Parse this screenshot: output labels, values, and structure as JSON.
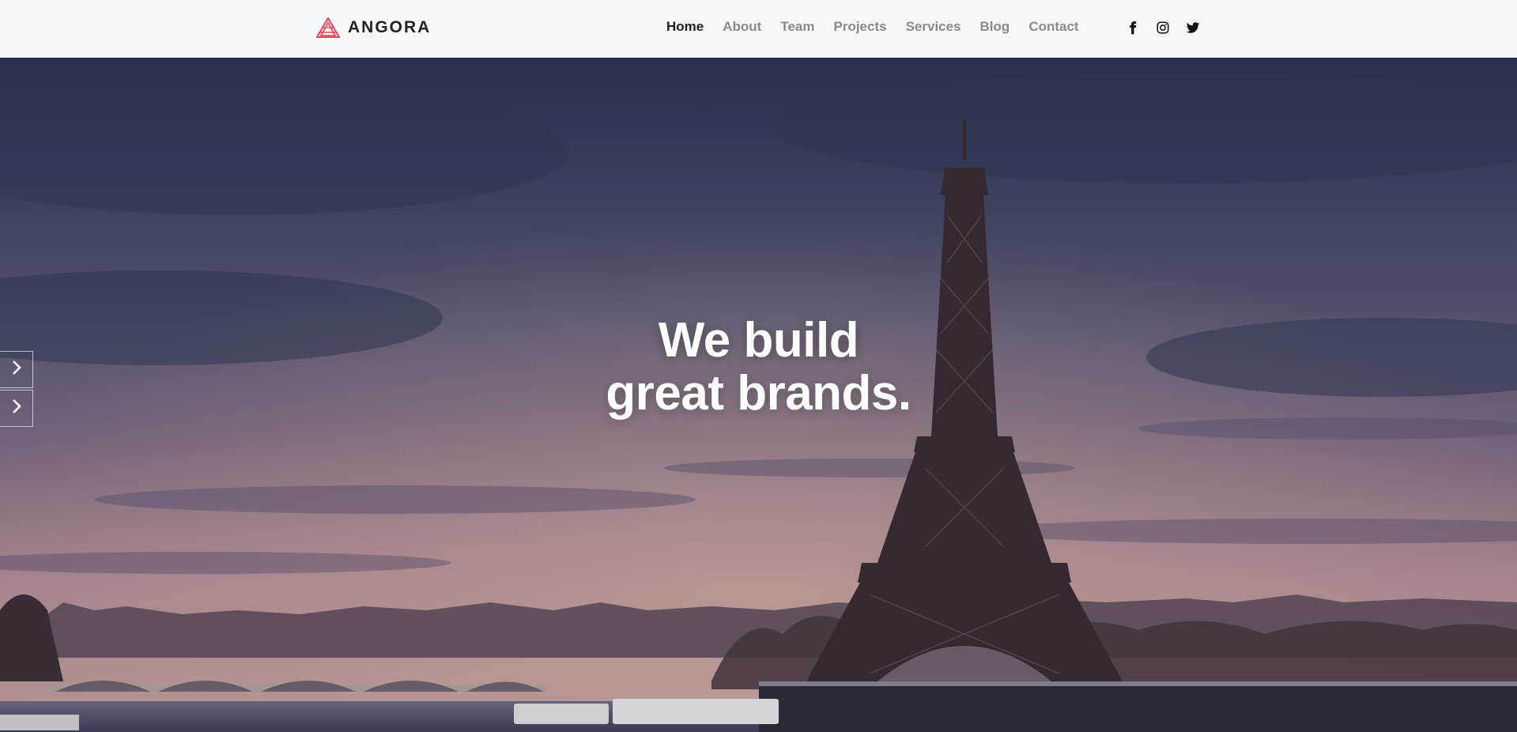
{
  "brand": {
    "name": "ANGORA",
    "accent": "#e84a5f",
    "icon": "triangle-logo-icon"
  },
  "nav": {
    "items": [
      {
        "label": "Home",
        "active": true
      },
      {
        "label": "About"
      },
      {
        "label": "Team"
      },
      {
        "label": "Projects"
      },
      {
        "label": "Services"
      },
      {
        "label": "Blog"
      },
      {
        "label": "Contact"
      }
    ]
  },
  "social": [
    "facebook-icon",
    "instagram-icon",
    "twitter-icon"
  ],
  "hero": {
    "line1": "We build",
    "line2": "great brands.",
    "arrows": [
      "chevron-right-icon",
      "chevron-right-icon"
    ]
  },
  "colors": {
    "header_bg": "#f7f8fa",
    "text_active": "#1f1f1f",
    "text_nav": "#8a8a8a"
  }
}
